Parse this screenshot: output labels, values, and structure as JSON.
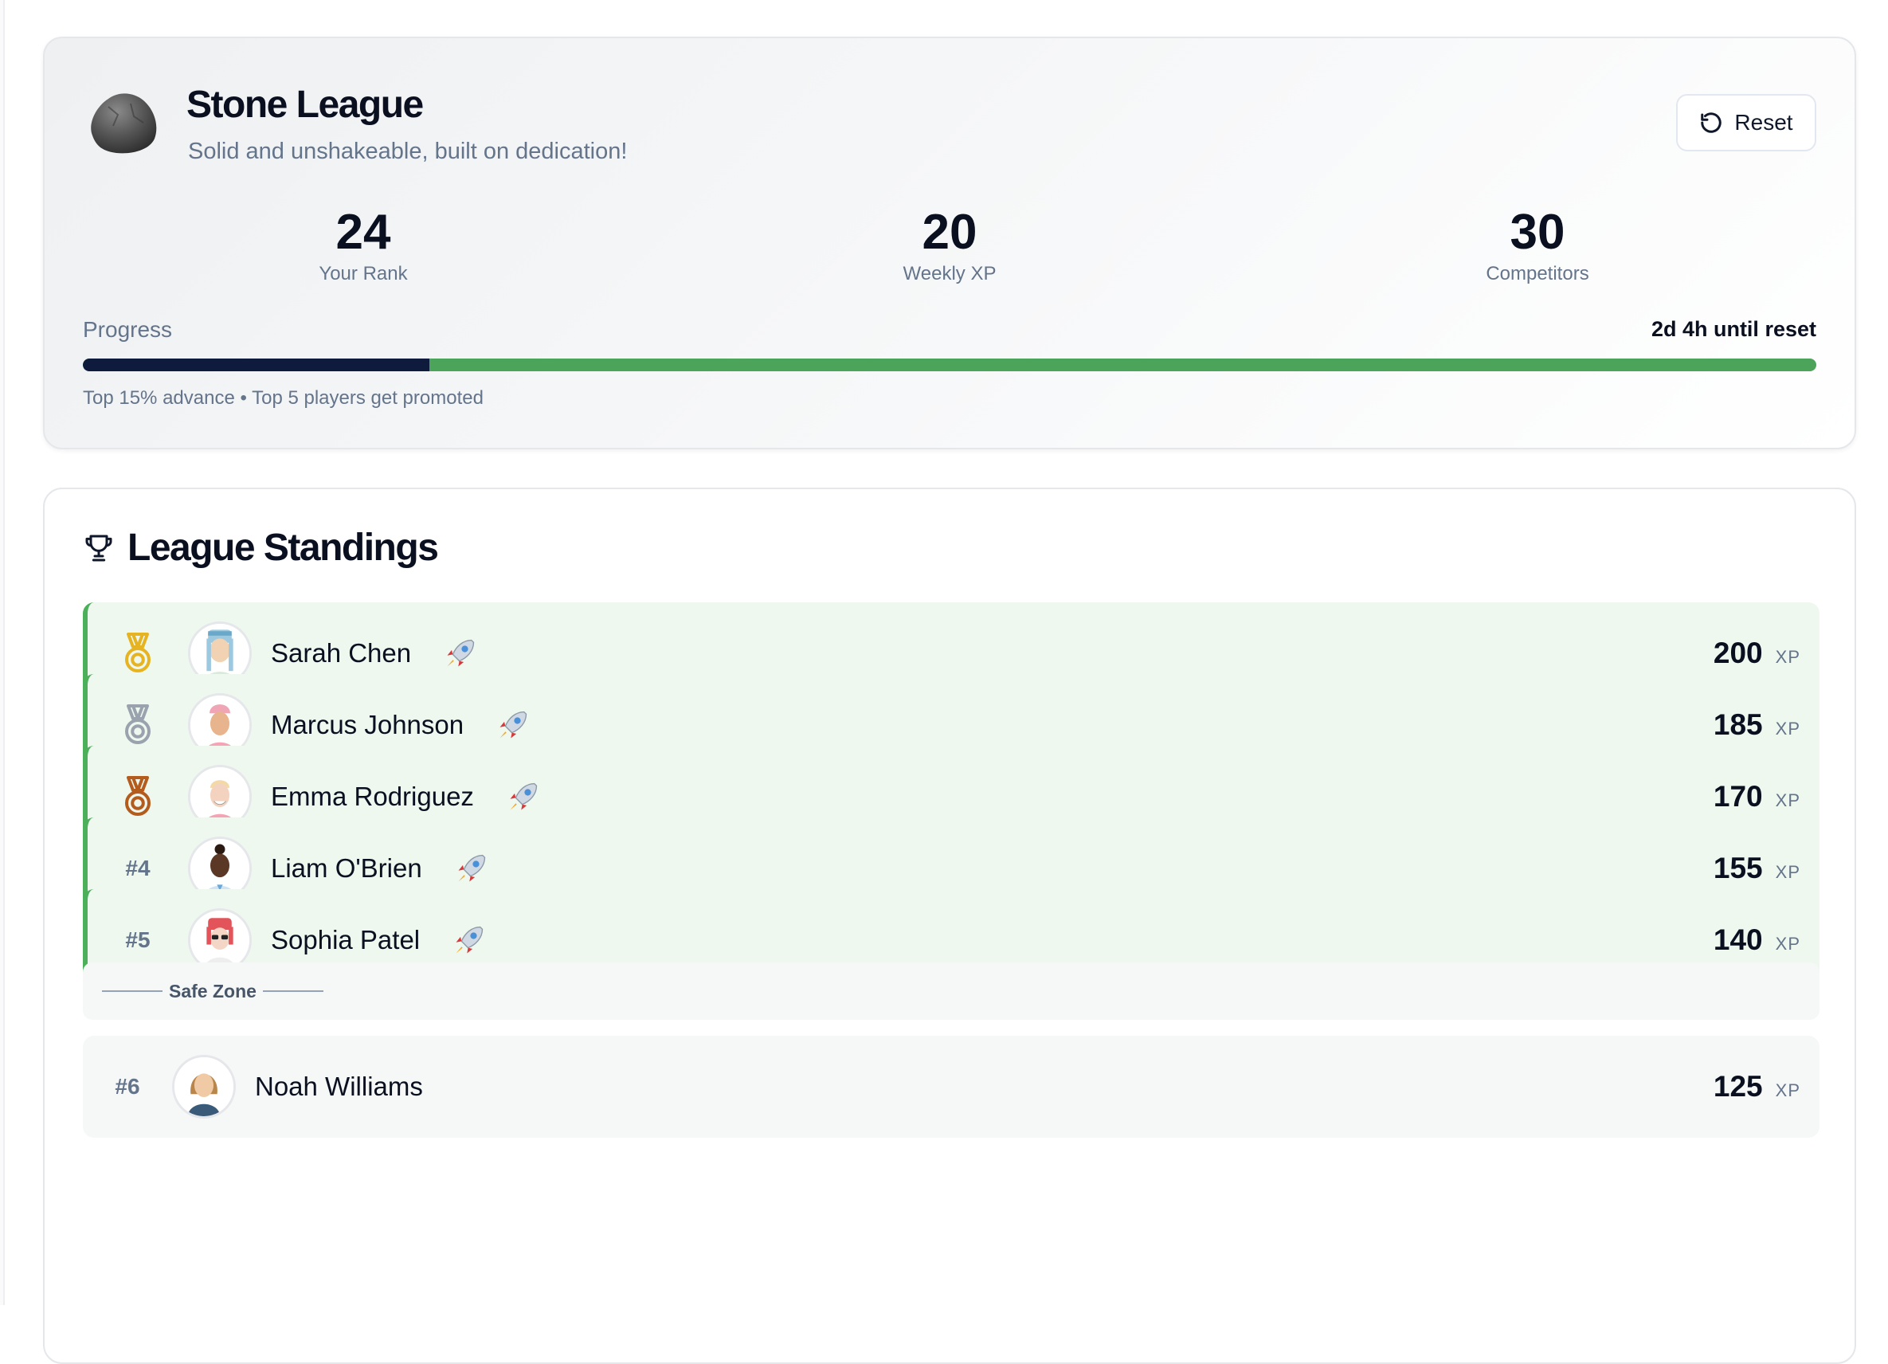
{
  "league": {
    "name": "Stone League",
    "tagline": "Solid and unshakeable, built on dedication!",
    "reset_label": "Reset"
  },
  "stats": {
    "rank": {
      "value": "24",
      "label": "Your Rank"
    },
    "weekly_xp": {
      "value": "20",
      "label": "Weekly XP"
    },
    "competitors": {
      "value": "30",
      "label": "Competitors"
    }
  },
  "progress": {
    "label": "Progress",
    "time_left": "2d 4h until reset",
    "fraction": 0.2,
    "note": "Top 15% advance • Top 5 players get promoted",
    "colors": {
      "filled": "#0f1b3d",
      "remaining": "#4ca35a"
    }
  },
  "standings": {
    "title": "League Standings",
    "safe_zone_label": "Safe Zone",
    "xp_unit": "XP",
    "rows": [
      {
        "rank": "#1",
        "medal": "gold",
        "name": "Sarah Chen",
        "xp": "200",
        "promoted": true
      },
      {
        "rank": "#2",
        "medal": "silver",
        "name": "Marcus Johnson",
        "xp": "185",
        "promoted": true
      },
      {
        "rank": "#3",
        "medal": "bronze",
        "name": "Emma Rodriguez",
        "xp": "170",
        "promoted": true
      },
      {
        "rank": "#4",
        "medal": null,
        "name": "Liam O'Brien",
        "xp": "155",
        "promoted": true
      },
      {
        "rank": "#5",
        "medal": null,
        "name": "Sophia Patel",
        "xp": "140",
        "promoted": true
      },
      {
        "rank": "#6",
        "medal": null,
        "name": "Noah Williams",
        "xp": "125",
        "promoted": false
      }
    ],
    "medal_colors": {
      "gold": "#e6b422",
      "silver": "#9aa3ad",
      "bronze": "#b45c1e"
    },
    "promoted_color": "#4caf59"
  }
}
